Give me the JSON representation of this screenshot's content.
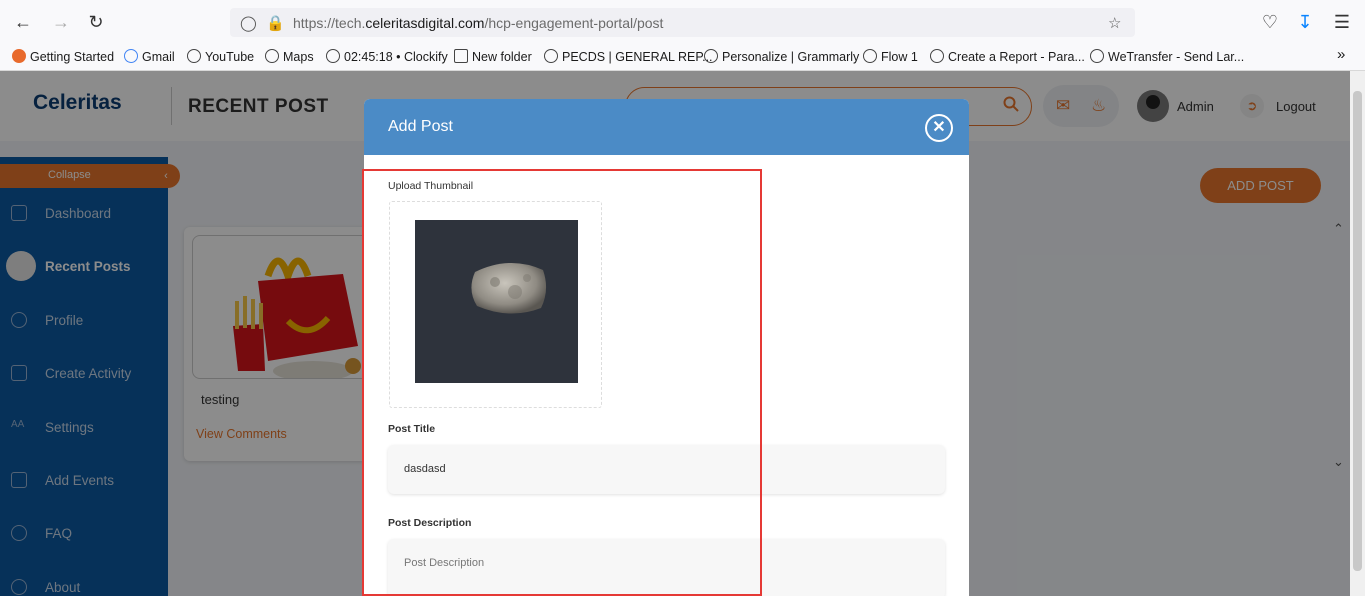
{
  "browser": {
    "url_prefix": "https://tech.",
    "url_domain": "celeritasdigital.com",
    "url_path": "/hcp-engagement-portal/post",
    "bookmarks": [
      {
        "label": "Getting Started"
      },
      {
        "label": "Gmail"
      },
      {
        "label": "YouTube"
      },
      {
        "label": "Maps"
      },
      {
        "label": "02:45:18 • Clockify"
      },
      {
        "label": "New folder"
      },
      {
        "label": "PECDS | GENERAL REP..."
      },
      {
        "label": "Personalize | Grammarly"
      },
      {
        "label": "Flow 1"
      },
      {
        "label": "Create a Report - Para..."
      },
      {
        "label": "WeTransfer - Send Lar..."
      }
    ]
  },
  "header": {
    "logo": "Celeritas",
    "page_title": "RECENT POST",
    "user_name": "Admin",
    "logout_label": "Logout"
  },
  "sidebar": {
    "collapse_label": "Collapse",
    "items": [
      {
        "label": "Dashboard",
        "icon": "dashboard-icon"
      },
      {
        "label": "Recent Posts",
        "icon": "posts-icon",
        "active": true
      },
      {
        "label": "Profile",
        "icon": "user-icon"
      },
      {
        "label": "Create Activity",
        "icon": "layers-icon"
      },
      {
        "label": "Settings",
        "icon": "font-size-icon"
      },
      {
        "label": "Add Events",
        "icon": "calendar-icon"
      },
      {
        "label": "FAQ",
        "icon": "chat-icon"
      },
      {
        "label": "About",
        "icon": "info-icon"
      }
    ]
  },
  "main": {
    "add_post_label": "ADD POST",
    "post_card": {
      "title": "testing",
      "view_comments": "View Comments"
    }
  },
  "modal": {
    "title": "Add Post",
    "upload_label": "Upload Thumbnail",
    "post_title_label": "Post Title",
    "post_title_value": "dasdasd",
    "post_description_label": "Post Description",
    "post_description_placeholder": "Post Description"
  },
  "colors": {
    "accent": "#e8762c",
    "sidebar": "#0b5aa2",
    "modal_header": "#4b8bc6",
    "highlight": "#e53935"
  }
}
